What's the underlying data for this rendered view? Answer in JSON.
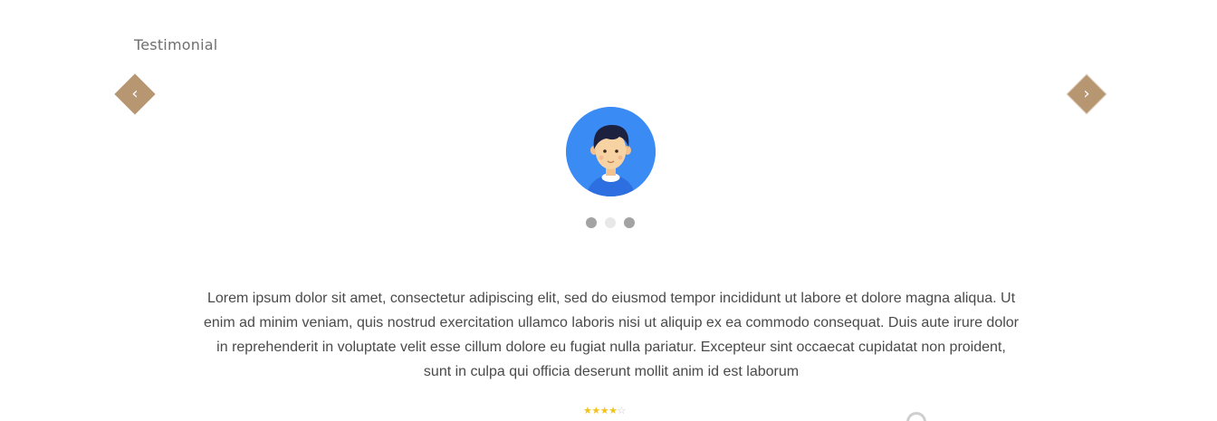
{
  "section": {
    "title": "Testimonial"
  },
  "navigation": {
    "prev_icon": "chevron-left-icon",
    "next_icon": "chevron-right-icon",
    "prev_glyph": "‹",
    "next_glyph": "›"
  },
  "testimonial": {
    "avatar_icon": "user-avatar-icon",
    "quote": "Lorem ipsum dolor sit amet, consectetur adipiscing elit, sed do eiusmod tempor incididunt ut labore et dolore magna aliqua. Ut enim ad minim veniam, quis nostrud exercitation ullamco laboris nisi ut aliquip ex ea commodo consequat. Duis aute irure dolor in reprehenderit in voluptate velit esse cillum dolore eu fugiat nulla pariatur. Excepteur sint occaecat cupidatat non proident, sunt in culpa qui officia deserunt mollit anim id est laborum",
    "rating": 4,
    "rating_max": 5
  },
  "pagination": {
    "count": 3,
    "active_index": 1
  },
  "colors": {
    "accent": "#b79672",
    "avatar_bg": "#3b8bf5",
    "star": "#f3c31a",
    "text": "#4a4a4a"
  }
}
